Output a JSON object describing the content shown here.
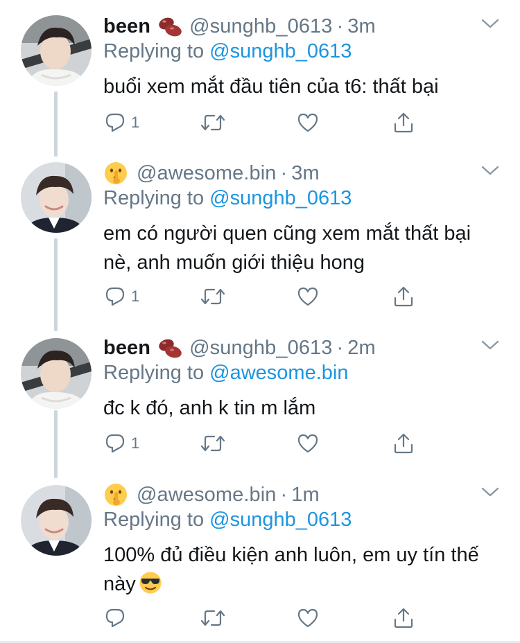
{
  "tweets": [
    {
      "display_name": "been",
      "name_emoji": "kidney-beans-emoji",
      "handle": "@sunghb_0613",
      "separator": "·",
      "time": "3m",
      "replying_prefix": "Replying to",
      "replying_to": "@sunghb_0613",
      "text": "buổi xem mắt đầu tiên của t6: thất bại",
      "reply_count": "1"
    },
    {
      "display_name": "",
      "name_emoji": "shushing-face-emoji",
      "handle": "@awesome.bin",
      "separator": "·",
      "time": "3m",
      "replying_prefix": "Replying to",
      "replying_to": "@sunghb_0613",
      "text": "em có người quen cũng xem mắt thất bại nè, anh muốn giới thiệu hong",
      "reply_count": "1"
    },
    {
      "display_name": "been",
      "name_emoji": "kidney-beans-emoji",
      "handle": "@sunghb_0613",
      "separator": "·",
      "time": "2m",
      "replying_prefix": "Replying to",
      "replying_to": "@awesome.bin",
      "text": "đc k đó, anh k tin m lắm",
      "reply_count": "1"
    },
    {
      "display_name": "",
      "name_emoji": "shushing-face-emoji",
      "handle": "@awesome.bin",
      "separator": "·",
      "time": "1m",
      "replying_prefix": "Replying to",
      "replying_to": "@sunghb_0613",
      "text": "100% đủ điều kiện anh luôn, em uy tín thế này",
      "text_emoji": "smiling-face-with-sunglasses-emoji",
      "reply_count": ""
    }
  ],
  "colors": {
    "text_primary": "#14171a",
    "text_secondary": "#657786",
    "link": "#1b95e0",
    "thread_line": "#ccd6dd"
  },
  "icons": [
    "reply-icon",
    "retweet-icon",
    "like-icon",
    "share-icon",
    "chevron-down-icon"
  ]
}
